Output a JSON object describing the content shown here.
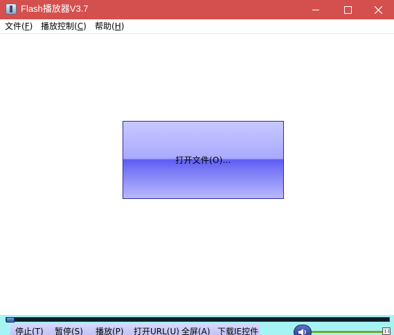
{
  "window": {
    "title": "Flash播放器V3.7"
  },
  "menu": {
    "items": [
      {
        "label": "文件(",
        "key": "F",
        "suffix": ")"
      },
      {
        "label": "播放控制(",
        "key": "C",
        "suffix": ")"
      },
      {
        "label": "帮助(",
        "key": "H",
        "suffix": ")"
      }
    ]
  },
  "main": {
    "open_button_label": "打开文件(O)..."
  },
  "controls": {
    "stop": "停止(T)",
    "pause": "暂停(S)",
    "play": "播放(P)",
    "open_url": "打开URL(U)",
    "fullscreen": "全屏(A)",
    "download_control": "下载IE控件",
    "progress": 0,
    "volume": 1.0
  },
  "icons": {
    "app": "flash-player-app-icon",
    "volume": "speaker-icon"
  },
  "colors": {
    "titlebar": "#d4504f",
    "controls_bg": "#a6f3f3",
    "open_button_top": "#c8c8ff",
    "open_button_mid": "#5c5cf4"
  }
}
